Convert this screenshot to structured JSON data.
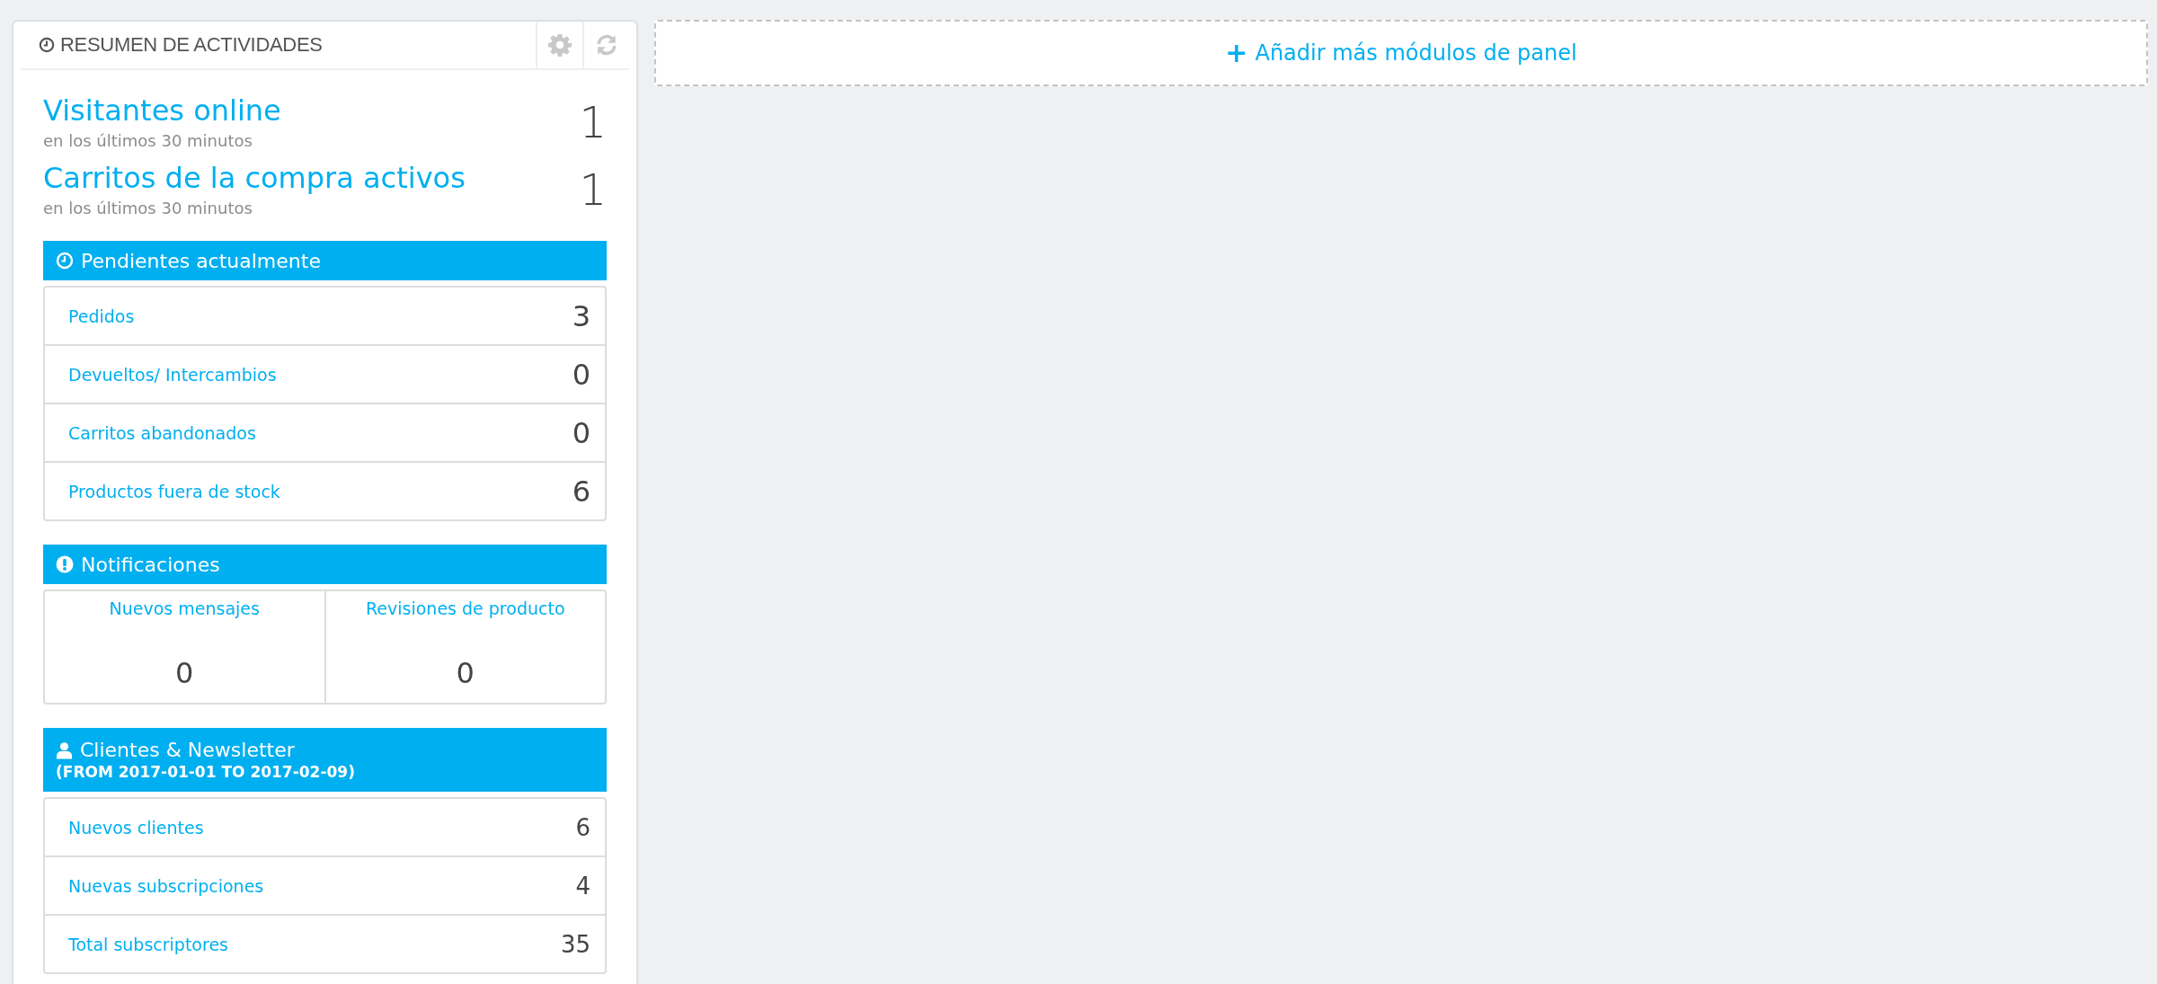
{
  "panel": {
    "title": "RESUMEN DE ACTIVIDADES"
  },
  "online": [
    {
      "label": "Visitantes online",
      "note": "en los últimos 30 minutos",
      "value": "1"
    },
    {
      "label": "Carritos de la compra activos",
      "note": "en los últimos 30 minutos",
      "value": "1"
    }
  ],
  "pending": {
    "title": "Pendientes actualmente",
    "rows": [
      {
        "label": "Pedidos",
        "value": "3"
      },
      {
        "label": "Devueltos/ Intercambios",
        "value": "0"
      },
      {
        "label": "Carritos abandonados",
        "value": "0"
      },
      {
        "label": "Productos fuera de stock",
        "value": "6"
      }
    ]
  },
  "notifications": {
    "title": "Notificaciones",
    "cells": [
      {
        "label": "Nuevos mensajes",
        "value": "0"
      },
      {
        "label": "Revisiones de producto",
        "value": "0"
      }
    ]
  },
  "customers": {
    "title": "Clientes & Newsletter",
    "subtitle": "(FROM 2017-01-01 TO 2017-02-09)",
    "rows": [
      {
        "label": "Nuevos clientes",
        "value": "6"
      },
      {
        "label": "Nuevas subscripciones",
        "value": "4"
      },
      {
        "label": "Total subscriptores",
        "value": "35"
      }
    ]
  },
  "add_button": {
    "label": "Añadir más módulos de panel",
    "icon": "+"
  }
}
